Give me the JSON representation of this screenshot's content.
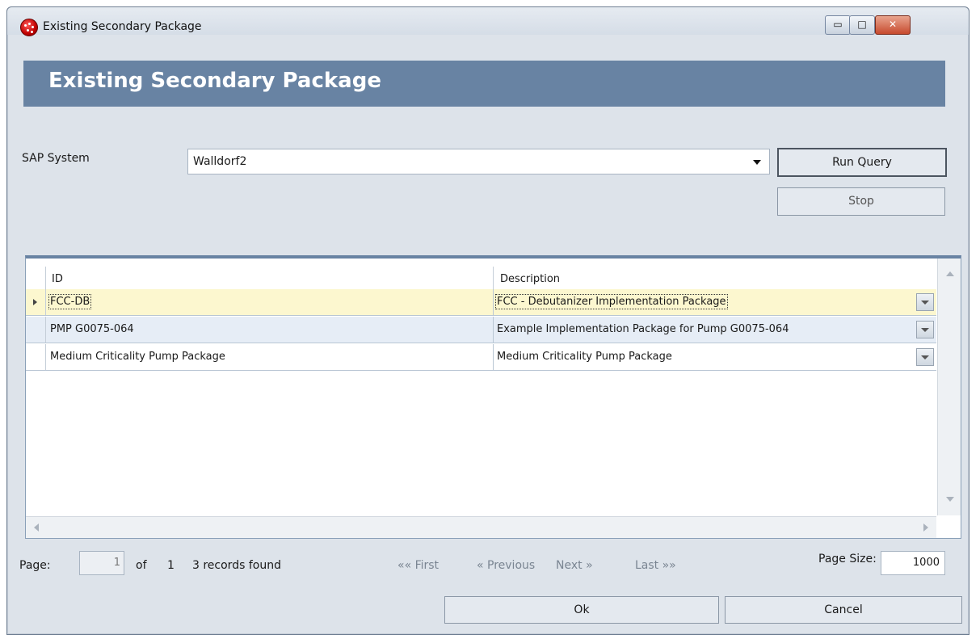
{
  "window": {
    "title": "Existing Secondary Package",
    "minimize": "▭",
    "maximize": "□",
    "close": "✕"
  },
  "banner": {
    "title": "Existing Secondary Package"
  },
  "form": {
    "sap_label": "SAP System",
    "sap_value": "Walldorf2",
    "run_query": "Run Query",
    "stop": "Stop"
  },
  "grid": {
    "columns": [
      "ID",
      "Description"
    ],
    "rows": [
      {
        "id": "FCC-DB",
        "description": "FCC - Debutanizer Implementation Package"
      },
      {
        "id": "PMP G0075-064",
        "description": "Example Implementation Package for Pump G0075-064"
      },
      {
        "id": "Medium Criticality Pump Package",
        "description": "Medium Criticality Pump Package"
      }
    ]
  },
  "pager": {
    "page_label": "Page:",
    "page_value": "1",
    "of_label": "of",
    "total_pages": "1",
    "records": "3 records found",
    "first": "«« First",
    "previous": "« Previous",
    "next": "Next »",
    "last": "Last »»",
    "page_size_label": "Page Size:",
    "page_size_value": "1000"
  },
  "actions": {
    "ok": "Ok",
    "cancel": "Cancel"
  }
}
